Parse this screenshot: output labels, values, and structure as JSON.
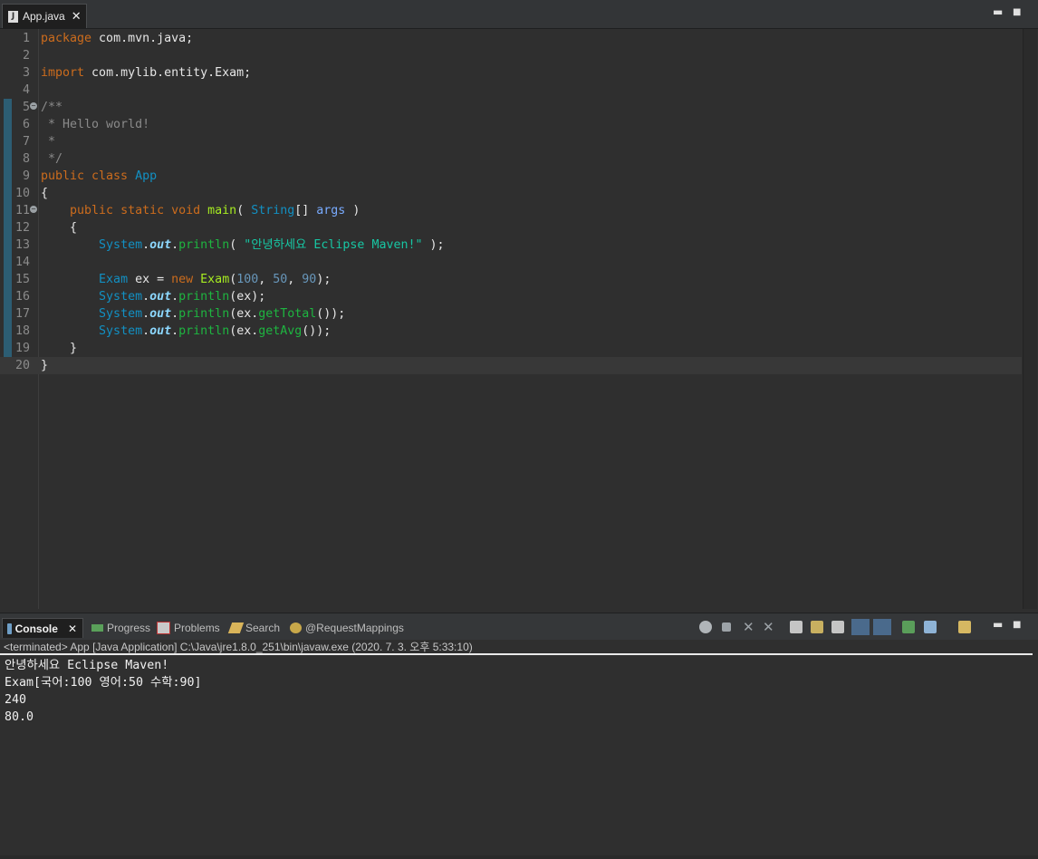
{
  "editor": {
    "tab_title": "App.java",
    "tab_close": "✕",
    "minimize": "▬",
    "maximize": "■",
    "lines": [
      {
        "n": "1",
        "segs": [
          {
            "c": "kw",
            "t": "package"
          },
          {
            "c": "",
            "t": " com.mvn.java;"
          }
        ]
      },
      {
        "n": "2",
        "segs": []
      },
      {
        "n": "3",
        "segs": [
          {
            "c": "kw",
            "t": "import"
          },
          {
            "c": "",
            "t": " com.mylib.entity.Exam;"
          }
        ]
      },
      {
        "n": "4",
        "segs": []
      },
      {
        "n": "5",
        "fold": true,
        "segs": [
          {
            "c": "cm",
            "t": "/**"
          }
        ]
      },
      {
        "n": "6",
        "segs": [
          {
            "c": "cm",
            "t": " * Hello world!"
          }
        ]
      },
      {
        "n": "7",
        "segs": [
          {
            "c": "cm",
            "t": " *"
          }
        ]
      },
      {
        "n": "8",
        "segs": [
          {
            "c": "cm",
            "t": " */"
          }
        ]
      },
      {
        "n": "9",
        "segs": [
          {
            "c": "kw",
            "t": "public class"
          },
          {
            "c": "",
            "t": " "
          },
          {
            "c": "ty",
            "t": "App"
          }
        ]
      },
      {
        "n": "10",
        "segs": [
          {
            "c": "",
            "t": "{"
          }
        ]
      },
      {
        "n": "11",
        "fold": true,
        "segs": [
          {
            "c": "",
            "t": "    "
          },
          {
            "c": "kw",
            "t": "public static void"
          },
          {
            "c": "",
            "t": " "
          },
          {
            "c": "fn",
            "t": "main"
          },
          {
            "c": "",
            "t": "( "
          },
          {
            "c": "ty",
            "t": "String"
          },
          {
            "c": "",
            "t": "[] "
          },
          {
            "c": "par",
            "t": "args"
          },
          {
            "c": "",
            "t": " )"
          }
        ]
      },
      {
        "n": "12",
        "segs": [
          {
            "c": "",
            "t": "    {"
          }
        ]
      },
      {
        "n": "13",
        "segs": [
          {
            "c": "",
            "t": "        "
          },
          {
            "c": "ty",
            "t": "System"
          },
          {
            "c": "",
            "t": "."
          },
          {
            "c": "fld",
            "t": "out"
          },
          {
            "c": "",
            "t": "."
          },
          {
            "c": "mth",
            "t": "println"
          },
          {
            "c": "",
            "t": "( "
          },
          {
            "c": "str",
            "t": "\"안녕하세요 Eclipse Maven!\""
          },
          {
            "c": "",
            "t": " );"
          }
        ]
      },
      {
        "n": "14",
        "segs": []
      },
      {
        "n": "15",
        "segs": [
          {
            "c": "",
            "t": "        "
          },
          {
            "c": "ty",
            "t": "Exam"
          },
          {
            "c": "",
            "t": " ex = "
          },
          {
            "c": "kw",
            "t": "new"
          },
          {
            "c": "",
            "t": " "
          },
          {
            "c": "fn",
            "t": "Exam"
          },
          {
            "c": "",
            "t": "("
          },
          {
            "c": "num",
            "t": "100"
          },
          {
            "c": "",
            "t": ", "
          },
          {
            "c": "num",
            "t": "50"
          },
          {
            "c": "",
            "t": ", "
          },
          {
            "c": "num",
            "t": "90"
          },
          {
            "c": "",
            "t": ");"
          }
        ]
      },
      {
        "n": "16",
        "segs": [
          {
            "c": "",
            "t": "        "
          },
          {
            "c": "ty",
            "t": "System"
          },
          {
            "c": "",
            "t": "."
          },
          {
            "c": "fld",
            "t": "out"
          },
          {
            "c": "",
            "t": "."
          },
          {
            "c": "mth",
            "t": "println"
          },
          {
            "c": "",
            "t": "(ex);"
          }
        ]
      },
      {
        "n": "17",
        "segs": [
          {
            "c": "",
            "t": "        "
          },
          {
            "c": "ty",
            "t": "System"
          },
          {
            "c": "",
            "t": "."
          },
          {
            "c": "fld",
            "t": "out"
          },
          {
            "c": "",
            "t": "."
          },
          {
            "c": "mth",
            "t": "println"
          },
          {
            "c": "",
            "t": "(ex."
          },
          {
            "c": "mth",
            "t": "getTotal"
          },
          {
            "c": "",
            "t": "());"
          }
        ]
      },
      {
        "n": "18",
        "segs": [
          {
            "c": "",
            "t": "        "
          },
          {
            "c": "ty",
            "t": "System"
          },
          {
            "c": "",
            "t": "."
          },
          {
            "c": "fld",
            "t": "out"
          },
          {
            "c": "",
            "t": "."
          },
          {
            "c": "mth",
            "t": "println"
          },
          {
            "c": "",
            "t": "(ex."
          },
          {
            "c": "mth",
            "t": "getAvg"
          },
          {
            "c": "",
            "t": "());"
          }
        ]
      },
      {
        "n": "19",
        "segs": [
          {
            "c": "",
            "t": "    }"
          }
        ]
      },
      {
        "n": "20",
        "current": true,
        "segs": [
          {
            "c": "",
            "t": "}"
          }
        ]
      }
    ]
  },
  "console": {
    "tabs": [
      {
        "label": "Console",
        "active": true,
        "icon": "console-icon"
      },
      {
        "label": "Progress",
        "active": false,
        "icon": "progress-icon"
      },
      {
        "label": "Problems",
        "active": false,
        "icon": "problems-icon"
      },
      {
        "label": "Search",
        "active": false,
        "icon": "search-icon"
      },
      {
        "label": "@RequestMappings",
        "active": false,
        "icon": "request-mappings-icon"
      }
    ],
    "close": "✕",
    "status_line": "<terminated> App [Java Application] C:\\Java\\jre1.8.0_251\\bin\\javaw.exe (2020. 7. 3. 오후 5:33:10)",
    "output": [
      "안녕하세요 Eclipse Maven!",
      "Exam[국어:100 영어:50 수학:90]",
      "240",
      "80.0"
    ],
    "toolbar_icons": [
      "sync-icon",
      "stop-icon",
      "remove-launch-icon",
      "remove-all-icon",
      "scroll-lock-icon",
      "word-wrap-icon",
      "show-when-output-icon",
      "show-when-error-icon",
      "pin-console-icon",
      "display-console-icon",
      "open-console-icon"
    ]
  },
  "colors": {
    "keyword": "#cc6c1d",
    "type": "#1290c3",
    "string": "#17c6a3",
    "number": "#6897bb"
  }
}
